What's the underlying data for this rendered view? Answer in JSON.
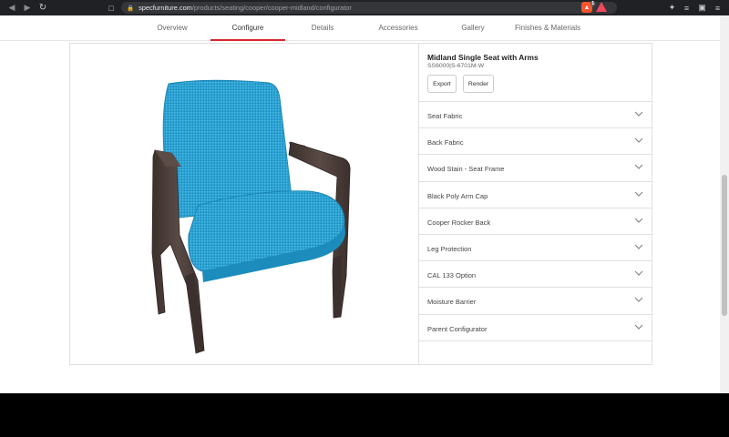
{
  "browser": {
    "url_host": "specfurniture.com",
    "url_path": "/products/seating/cooper/cooper-midland/configurator",
    "brave_badge": "1"
  },
  "tabs": [
    {
      "label": "Overview",
      "active": false
    },
    {
      "label": "Configure",
      "active": true
    },
    {
      "label": "Details",
      "active": false
    },
    {
      "label": "Accessories",
      "active": false
    },
    {
      "label": "Gallery",
      "active": false
    },
    {
      "label": "Finishes & Materials",
      "active": false
    }
  ],
  "product": {
    "title": "Midland Single Seat with Arms",
    "sku": "SS6000|S-6701M-W",
    "export_label": "Export",
    "render_label": "Render"
  },
  "options": [
    {
      "label": "Seat Fabric"
    },
    {
      "label": "Back Fabric"
    },
    {
      "label": "Wood Stain - Seat Frame"
    },
    {
      "label": "Black Poly Arm Cap"
    },
    {
      "label": "Cooper Rocker Back"
    },
    {
      "label": "Leg Protection"
    },
    {
      "label": "CAL 133 Option"
    },
    {
      "label": "Moisture Barrier"
    },
    {
      "label": "Parent Configurator"
    }
  ],
  "colors": {
    "accent": "#d6272e",
    "fabric": "#2aa3d4",
    "wood": "#4e3f3b"
  }
}
